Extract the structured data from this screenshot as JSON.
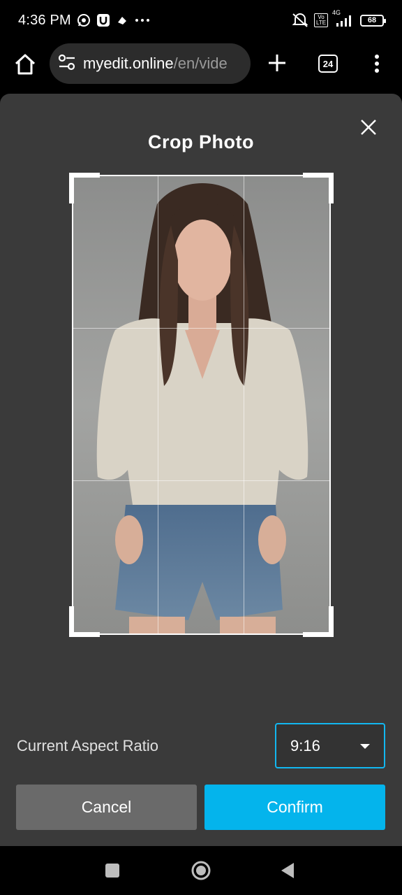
{
  "status_bar": {
    "time": "4:36 PM",
    "battery": "68",
    "network": "4G",
    "volte": "Vo LTE",
    "icons": [
      "whatsapp-icon",
      "app-u-icon",
      "cloud-icon",
      "more-dots-icon",
      "mute-icon",
      "signal-icon",
      "battery-icon"
    ]
  },
  "browser": {
    "url_host": "myedit.online",
    "url_path": "/en/vide",
    "tab_count": "24"
  },
  "modal": {
    "title": "Crop Photo",
    "aspect_ratio_label": "Current Aspect Ratio",
    "aspect_ratio_value": "9:16",
    "cancel_label": "Cancel",
    "confirm_label": "Confirm"
  },
  "colors": {
    "accent": "#04b4ec",
    "modal_bg": "#3a3a3a",
    "cancel_bg": "#6a6a6a"
  }
}
